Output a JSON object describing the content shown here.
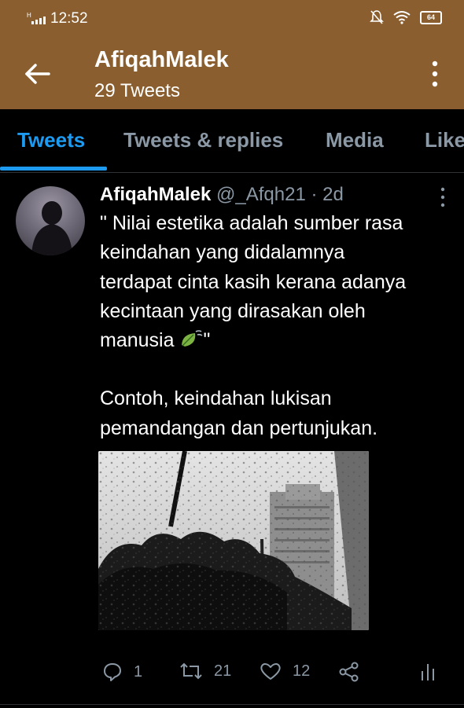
{
  "status_bar": {
    "time": "12:52",
    "network": "H",
    "battery": "64"
  },
  "header": {
    "title": "AfiqahMalek",
    "subtitle": "29 Tweets"
  },
  "tabs": [
    {
      "label": "Tweets",
      "active": true
    },
    {
      "label": "Tweets & replies",
      "active": false
    },
    {
      "label": "Media",
      "active": false
    },
    {
      "label": "Like",
      "active": false
    }
  ],
  "tweet": {
    "name": "AfiqahMalek",
    "handle": "@_Afqh21",
    "time": "· 2d",
    "lines": [
      "\" Nilai estetika adalah sumber rasa",
      "keindahan yang didalamnya",
      "terdapat cinta kasih  kerana adanya",
      "kecintaan yang dirasakan oleh",
      "manusia"
    ],
    "quote_close": "\"",
    "lines2": [
      "Contoh, keindahan lukisan",
      "pemandangan dan pertunjukan."
    ],
    "emoji": "leaf-fluttering-icon",
    "media_description": "black-and-white photo of raindrops on a window, trees and a tall building",
    "replies": "1",
    "retweets": "21",
    "likes": "12"
  },
  "colors": {
    "header_bg": "#8a5e2e",
    "accent": "#1d9bf0",
    "muted": "#8b98a5",
    "bg": "#000000"
  }
}
